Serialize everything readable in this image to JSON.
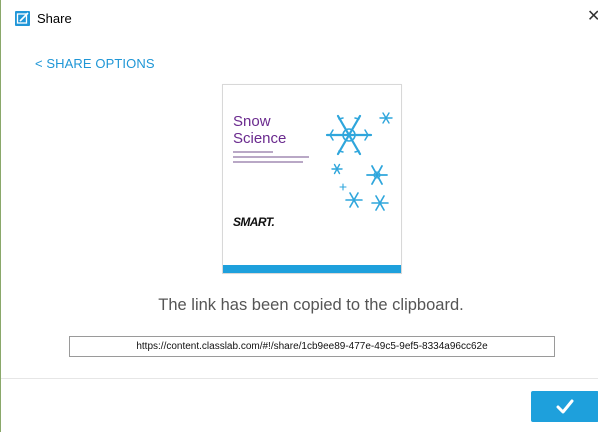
{
  "window": {
    "title": "Share",
    "close_glyph": "✕",
    "app_icon": "share-app-icon"
  },
  "navigation": {
    "back_link_label": "< SHARE OPTIONS"
  },
  "cover": {
    "title_line1": "Snow",
    "title_line2": "Science",
    "brand": "SMART.",
    "title_color": "#6a2a8e",
    "bar_color": "#1ea0dc",
    "art": "snowflakes"
  },
  "status": {
    "message": "The link has been copied to the clipboard."
  },
  "share_link": {
    "value": "https://content.classlab.com/#!/share/1cb9ee89-477e-49c5-9ef5-8334a96cc62e"
  },
  "footer": {
    "confirm_icon": "checkmark-icon",
    "accent_color": "#1ea0dc"
  }
}
